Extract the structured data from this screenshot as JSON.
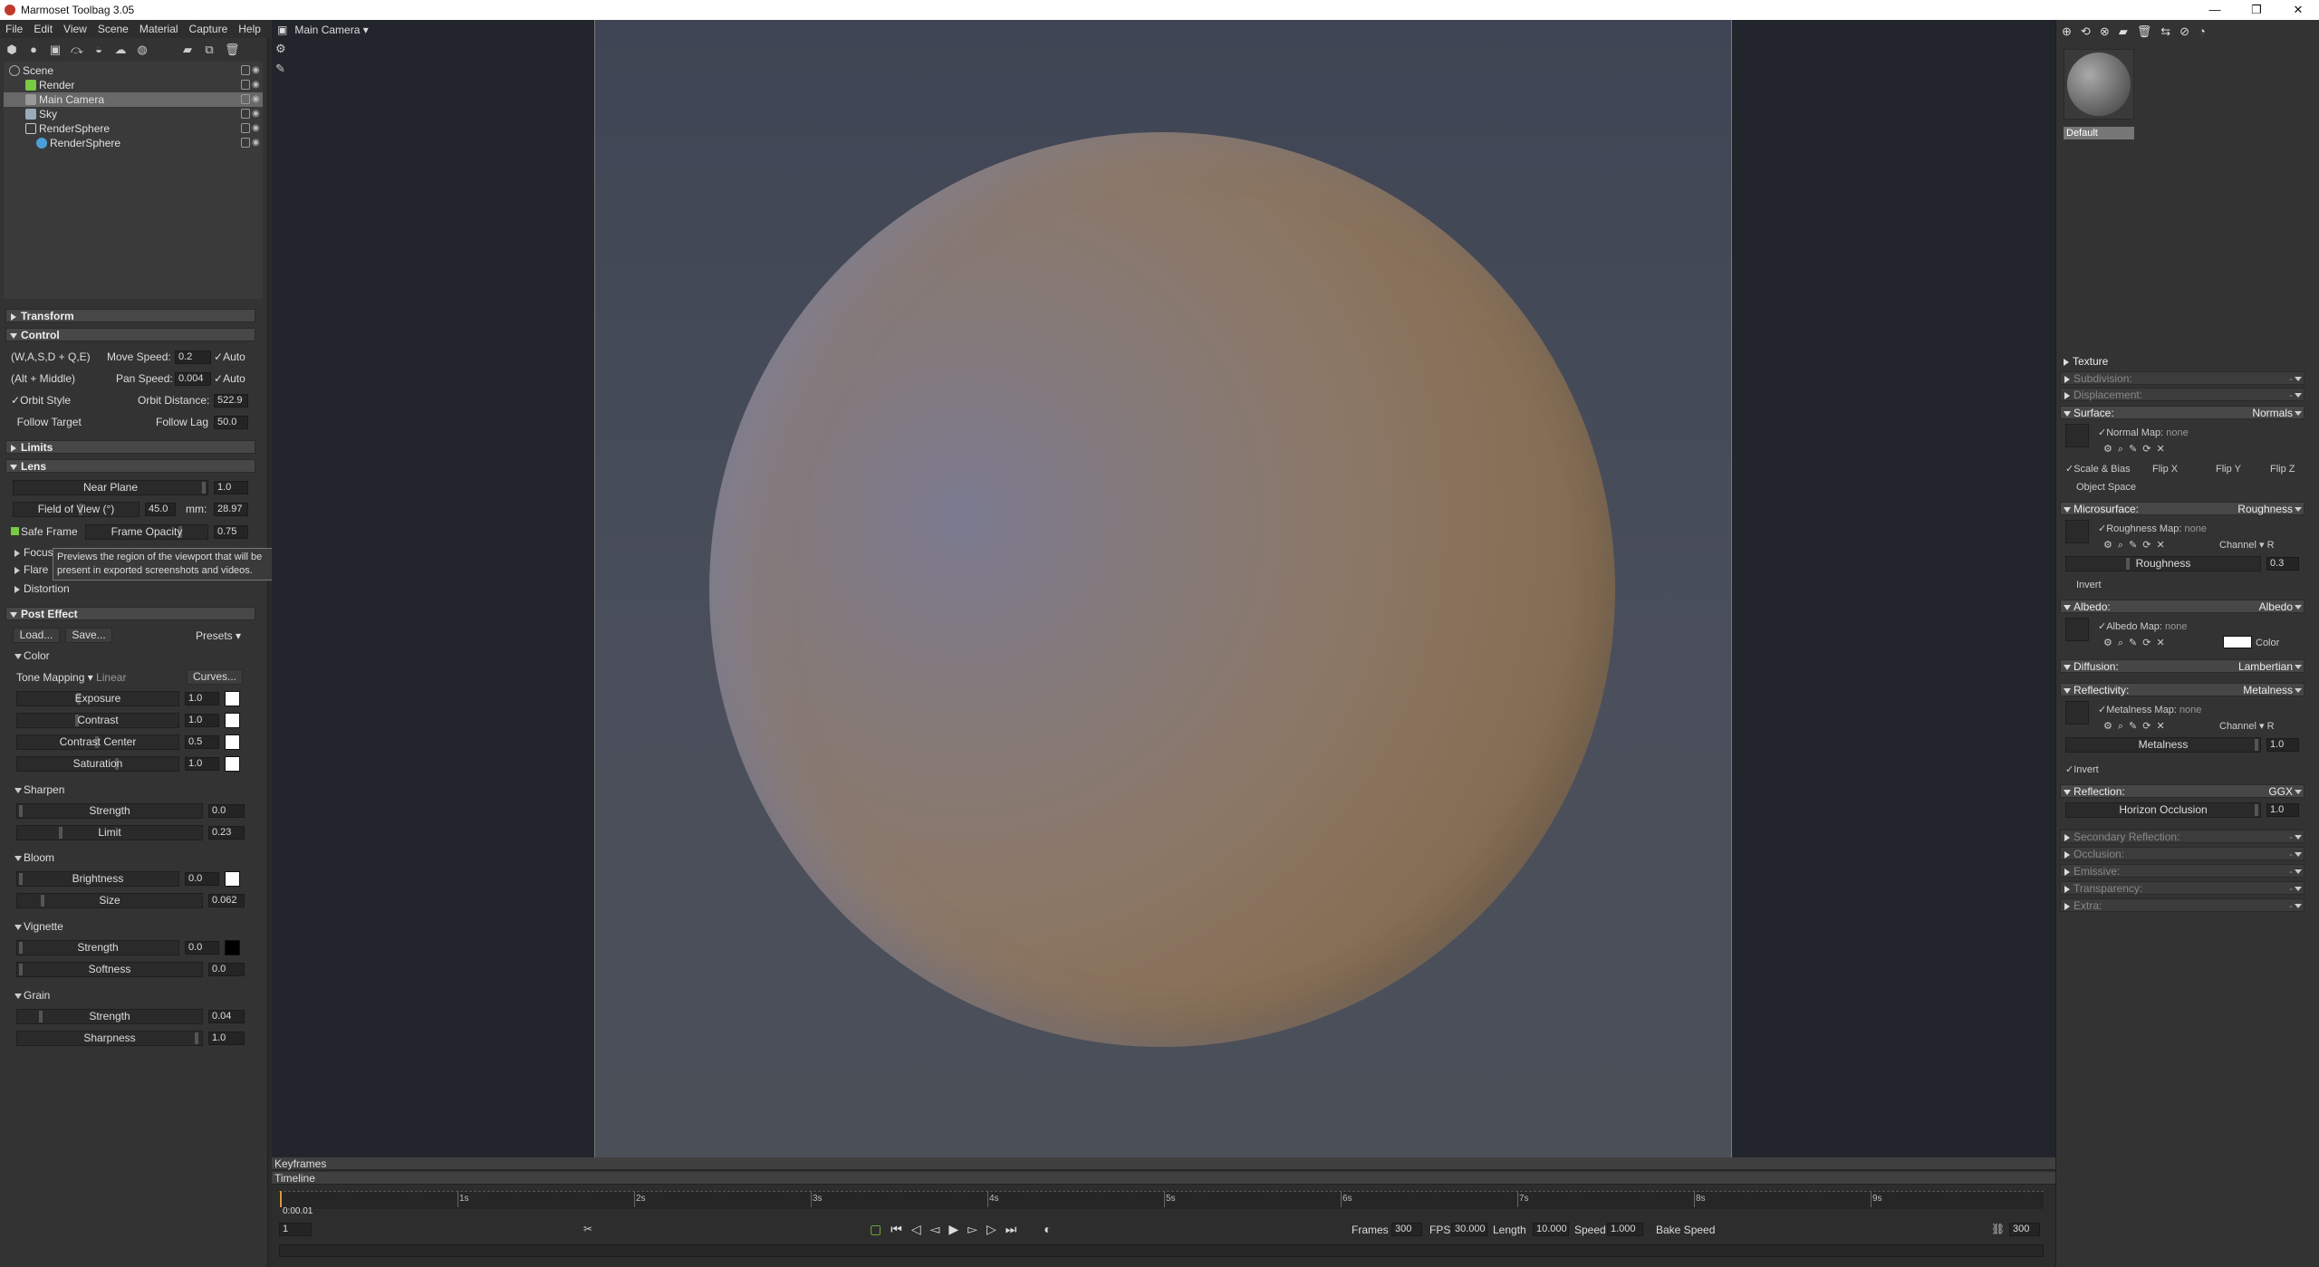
{
  "window": {
    "title": "Marmoset Toolbag 3.05"
  },
  "menu": [
    "File",
    "Edit",
    "View",
    "Scene",
    "Material",
    "Capture",
    "Help"
  ],
  "viewport": {
    "camera_label": "Main Camera"
  },
  "outliner": {
    "items": [
      "Scene",
      "Render",
      "Main Camera",
      "Sky",
      "RenderSphere",
      "RenderSphere"
    ]
  },
  "transform": {
    "title": "Transform"
  },
  "control": {
    "title": "Control",
    "keys_label": "(W,A,S,D + Q,E)",
    "move_speed_label": "Move Speed:",
    "move_speed": "0.2",
    "move_auto": "Auto",
    "alt_label": "(Alt + Middle)",
    "pan_speed_label": "Pan Speed:",
    "pan_speed": "0.004",
    "pan_auto": "Auto",
    "orbit_style": "Orbit Style",
    "orbit_distance_label": "Orbit Distance:",
    "orbit_distance": "522.9",
    "follow_target": "Follow Target",
    "follow_lag_label": "Follow Lag",
    "follow_lag": "50.0"
  },
  "limits": {
    "title": "Limits"
  },
  "lens": {
    "title": "Lens",
    "near_plane_label": "Near Plane",
    "near_plane": "1.0",
    "fov_label": "Field of View (°)",
    "fov": "45.0",
    "mm_label": "mm:",
    "mm": "28.97",
    "safe_frame": "Safe Frame",
    "frame_opacity_label": "Frame Opacity",
    "frame_opacity": "0.75",
    "focus": "Focus",
    "flare": "Flare",
    "distortion": "Distortion"
  },
  "tooltip": {
    "line1": "Previews the region of the viewport that will be",
    "line2": "present in exported screenshots and videos."
  },
  "post_effect": {
    "title": "Post Effect",
    "load": "Load...",
    "save": "Save...",
    "presets": "Presets",
    "color": {
      "title": "Color",
      "tone_mapping_label": "Tone Mapping",
      "tone_mapping_value": "Linear",
      "curves": "Curves...",
      "exposure_label": "Exposure",
      "exposure": "1.0",
      "contrast_label": "Contrast",
      "contrast": "1.0",
      "contrast_center_label": "Contrast Center",
      "contrast_center": "0.5",
      "saturation_label": "Saturation",
      "saturation": "1.0"
    },
    "sharpen": {
      "title": "Sharpen",
      "strength_label": "Strength",
      "strength": "0.0",
      "limit_label": "Limit",
      "limit": "0.23"
    },
    "bloom": {
      "title": "Bloom",
      "brightness_label": "Brightness",
      "brightness": "0.0",
      "size_label": "Size",
      "size": "0.062"
    },
    "vignette": {
      "title": "Vignette",
      "strength_label": "Strength",
      "strength": "0.0",
      "softness_label": "Softness",
      "softness": "0.0"
    },
    "grain": {
      "title": "Grain",
      "strength_label": "Strength",
      "strength": "0.04",
      "sharpness_label": "Sharpness",
      "sharpness": "1.0"
    }
  },
  "timeline": {
    "keyframes": "Keyframes",
    "timeline": "Timeline",
    "ticks": [
      "1s",
      "2s",
      "3s",
      "4s",
      "5s",
      "6s",
      "7s",
      "8s",
      "9s"
    ],
    "current_time": "0:00.01",
    "current_frame": "1",
    "frames_label": "Frames",
    "frames": "300",
    "fps_label": "FPS",
    "fps": "30.000",
    "length_label": "Length",
    "length": "10.000",
    "speed_label": "Speed",
    "speed": "1.000",
    "bake_speed": "Bake Speed",
    "end_frame": "300"
  },
  "material": {
    "name": "Default",
    "texture": "Texture",
    "subdivision": "Subdivision:",
    "displacement": "Displacement:",
    "surface": {
      "label": "Surface:",
      "value": "Normals",
      "map_label": "Normal Map:",
      "map_value": "none",
      "scale_bias": "Scale & Bias",
      "flip_x": "Flip X",
      "flip_y": "Flip Y",
      "flip_z": "Flip Z",
      "object_space": "Object Space"
    },
    "microsurface": {
      "label": "Microsurface:",
      "value": "Roughness",
      "map_label": "Roughness Map:",
      "map_value": "none",
      "channel": "Channel",
      "channel_value": "R",
      "roughness_label": "Roughness",
      "roughness": "0.3",
      "invert": "Invert"
    },
    "albedo": {
      "label": "Albedo:",
      "value": "Albedo",
      "map_label": "Albedo Map:",
      "map_value": "none",
      "color": "Color"
    },
    "diffusion": {
      "label": "Diffusion:",
      "value": "Lambertian"
    },
    "reflectivity": {
      "label": "Reflectivity:",
      "value": "Metalness",
      "map_label": "Metalness Map:",
      "map_value": "none",
      "channel": "Channel",
      "channel_value": "R",
      "metalness_label": "Metalness",
      "metalness": "1.0",
      "invert": "Invert"
    },
    "reflection": {
      "label": "Reflection:",
      "value": "GGX",
      "horizon_label": "Horizon Occlusion",
      "horizon": "1.0"
    },
    "secondary_reflection": "Secondary Reflection:",
    "occlusion": "Occlusion:",
    "emissive": "Emissive:",
    "transparency": "Transparency:",
    "extra": "Extra:"
  },
  "colors": {
    "accent_green": "#7ac943",
    "selected_row": "#686868",
    "panel_bg": "#333333"
  }
}
